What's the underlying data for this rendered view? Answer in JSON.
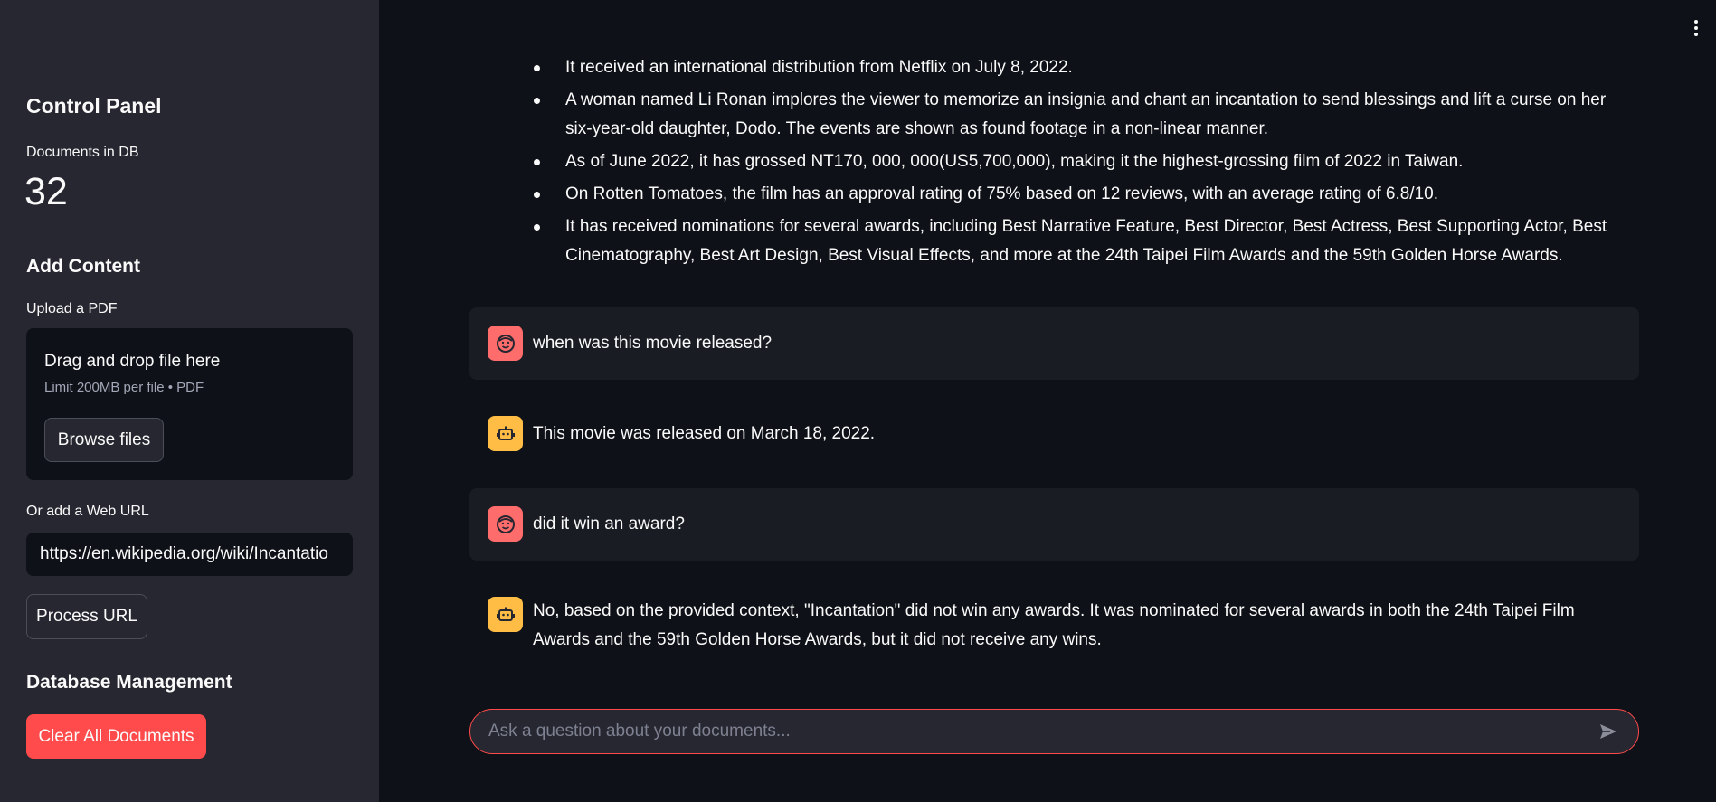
{
  "sidebar": {
    "title": "Control Panel",
    "metric_label": "Documents in DB",
    "metric_value": "32",
    "add_content_heading": "Add Content",
    "upload_label": "Upload a PDF",
    "dropzone_title": "Drag and drop file here",
    "dropzone_subtitle": "Limit 200MB per file • PDF",
    "browse_label": "Browse files",
    "url_label": "Or add a Web URL",
    "url_value": "https://en.wikipedia.org/wiki/Incantatio",
    "process_label": "Process URL",
    "db_heading": "Database Management",
    "clear_label": "Clear All Documents"
  },
  "bullets": [
    "It received an international distribution from Netflix on July 8, 2022.",
    "A woman named Li Ronan implores the viewer to memorize an insignia and chant an incantation to send blessings and lift a curse on her six-year-old daughter, Dodo. The events are shown as found footage in a non-linear manner.",
    "As of June 2022, it has grossed NT170, 000, 000(US5,700,000), making it the highest-grossing film of 2022 in Taiwan.",
    "On Rotten Tomatoes, the film has an approval rating of 75% based on 12 reviews, with an average rating of 6.8/10.",
    "It has received nominations for several awards, including Best Narrative Feature, Best Director, Best Actress, Best Supporting Actor, Best Cinematography, Best Art Design, Best Visual Effects, and more at the 24th Taipei Film Awards and the 59th Golden Horse Awards."
  ],
  "messages": [
    {
      "role": "user",
      "avatar_icon": "user-face-icon",
      "text": "when was this movie released?"
    },
    {
      "role": "assistant",
      "avatar_icon": "robot-icon",
      "text": "This movie was released on March 18, 2022."
    },
    {
      "role": "user",
      "avatar_icon": "user-face-icon",
      "text": "did it win an award?"
    },
    {
      "role": "assistant",
      "avatar_icon": "robot-icon",
      "text": "No, based on the provided context, \"Incantation\" did not win any awards. It was nominated for several awards in both the 24th Taipei Film Awards and the 59th Golden Horse Awards, but it did not receive any wins."
    }
  ],
  "chat_input": {
    "placeholder": "Ask a question about your documents..."
  },
  "colors": {
    "accent": "#ff4b4b",
    "user_avatar": "#ff6c6c",
    "bot_avatar": "#ffbd45",
    "sidebar_bg": "#262730",
    "main_bg": "#0e1117"
  }
}
